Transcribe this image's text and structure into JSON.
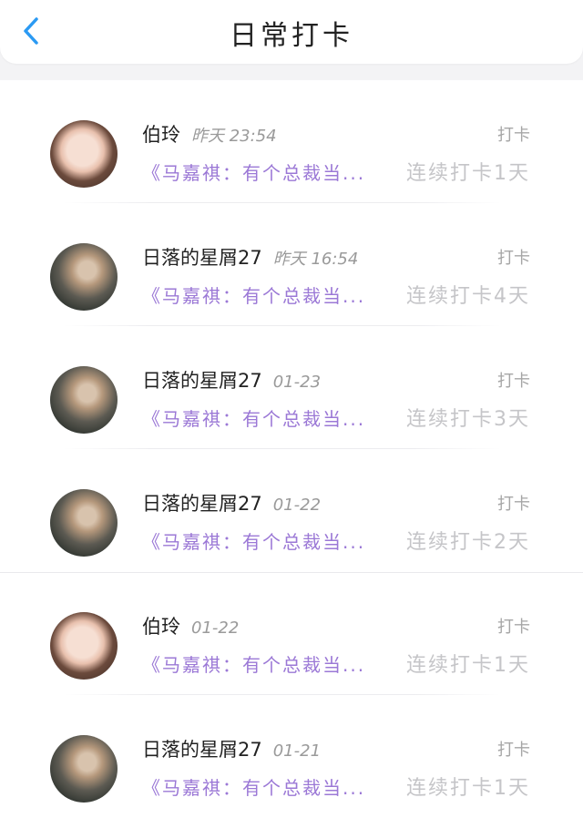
{
  "header": {
    "title": "日常打卡",
    "accent_color": "#2b9af3"
  },
  "entries": [
    {
      "name": "伯玲",
      "time": "昨天 23:54",
      "action": "打卡",
      "preview": "《马嘉祺：有个总裁当...",
      "streak": "连续打卡1天",
      "avatar": "girl-photo-light"
    },
    {
      "name": "日落的星屑27",
      "time": "昨天 16:54",
      "action": "打卡",
      "preview": "《马嘉祺：有个总裁当...",
      "streak": "连续打卡4天",
      "avatar": "girl-photo-dark"
    },
    {
      "name": "日落的星屑27",
      "time": "01-23",
      "action": "打卡",
      "preview": "《马嘉祺：有个总裁当...",
      "streak": "连续打卡3天",
      "avatar": "girl-photo-dark"
    },
    {
      "name": "日落的星屑27",
      "time": "01-22",
      "action": "打卡",
      "preview": "《马嘉祺：有个总裁当...",
      "streak": "连续打卡2天",
      "avatar": "girl-photo-dark"
    },
    {
      "name": "伯玲",
      "time": "01-22",
      "action": "打卡",
      "preview": "《马嘉祺：有个总裁当...",
      "streak": "连续打卡1天",
      "avatar": "girl-photo-light"
    },
    {
      "name": "日落的星屑27",
      "time": "01-21",
      "action": "打卡",
      "preview": "《马嘉祺：有个总裁当...",
      "streak": "连续打卡1天",
      "avatar": "girl-photo-dark"
    }
  ],
  "colors": {
    "preview": "#9b78d6",
    "streak": "#c5c5c8",
    "time": "#9a9a9a"
  }
}
